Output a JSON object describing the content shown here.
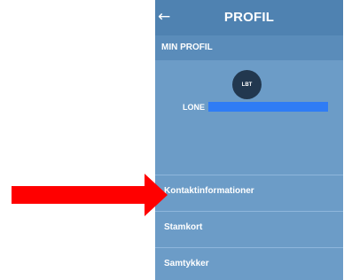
{
  "header": {
    "back_icon": "←",
    "title": "PROFIL"
  },
  "section": {
    "title": "MIN PROFIL"
  },
  "profile": {
    "initials": "LBT",
    "name": "LONE"
  },
  "menu": {
    "items": [
      {
        "label": "Kontaktinformationer"
      },
      {
        "label": "Stamkort"
      },
      {
        "label": "Samtykker"
      }
    ]
  },
  "colors": {
    "appbar": "#4f82b1",
    "section_band": "#5a8cba",
    "background": "#6c9cc7",
    "avatar": "#22384f",
    "redaction": "#2f7cf5",
    "annotation_arrow": "#ff0000"
  }
}
